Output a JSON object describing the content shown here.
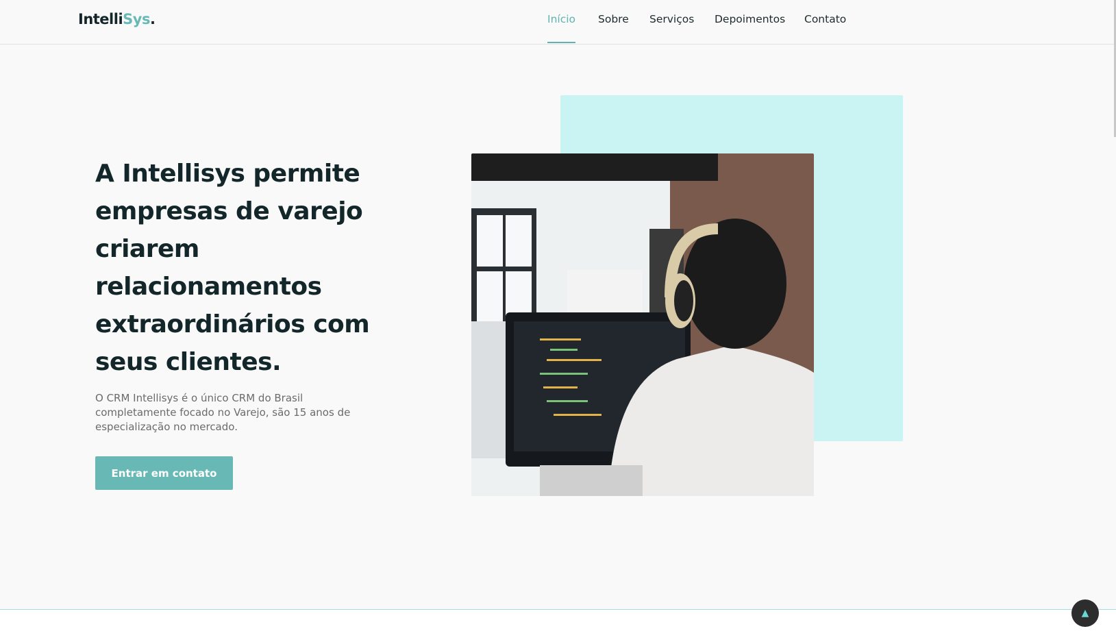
{
  "header": {
    "logo": {
      "part1": "Intelli",
      "part2": "Sys",
      "dot": "."
    },
    "nav": [
      {
        "label": "Início",
        "active": true
      },
      {
        "label": "Sobre"
      },
      {
        "label": "Serviços"
      },
      {
        "label": "Depoimentos"
      },
      {
        "label": "Contato"
      }
    ]
  },
  "hero": {
    "headline": "A Intellisys permite empresas de varejo criarem relacionamentos extraordinários com seus clientes.",
    "description": "O CRM Intellisys é o único CRM do Brasil completamente focado no Varejo, são 15 anos de especialização no mercado.",
    "cta_label": "Entrar em contato",
    "image_alt_icon": "photo-developer-headphones"
  },
  "scroll_top": {
    "icon": "arrow-up-icon",
    "glyph": "▲"
  },
  "colors": {
    "accent": "#68b9b6",
    "accent_light": "#caf3f3",
    "text": "#13272a"
  }
}
